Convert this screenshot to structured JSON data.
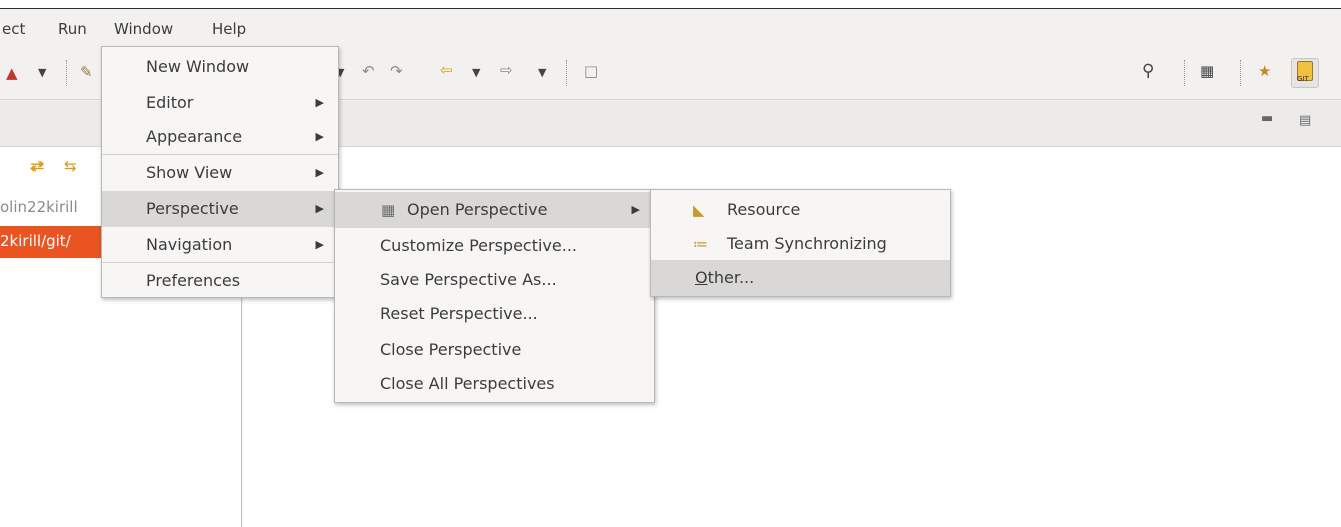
{
  "menubar": {
    "items": [
      "ect",
      "Run",
      "Window",
      "Help"
    ],
    "active": "Window"
  },
  "toolbar": {
    "git_label": "GIT"
  },
  "left_panel": {
    "path_line_1": "olin22kirill",
    "path_line_2": "2kirill/git/"
  },
  "window_menu": {
    "items": [
      {
        "label": "New Window"
      },
      {
        "label": "Editor"
      },
      {
        "label": "Appearance"
      },
      {
        "label": "Show View"
      },
      {
        "label": "Perspective"
      },
      {
        "label": "Navigation"
      },
      {
        "label": "Preferences"
      }
    ]
  },
  "perspective_menu": {
    "items": [
      {
        "label": "Open Perspective"
      },
      {
        "label": "Customize Perspective..."
      },
      {
        "label": "Save Perspective As..."
      },
      {
        "label": "Reset Perspective..."
      },
      {
        "label": "Close Perspective"
      },
      {
        "label": "Close All Perspectives"
      }
    ]
  },
  "open_perspective_menu": {
    "items": [
      {
        "label": "Resource"
      },
      {
        "label": "Team Synchronizing"
      },
      {
        "label_first": "O",
        "label_rest": "ther..."
      }
    ]
  },
  "colors": {
    "accent": "#e95420",
    "highlight": "#d9d8d7",
    "menu_bg": "#f7f6f5"
  }
}
